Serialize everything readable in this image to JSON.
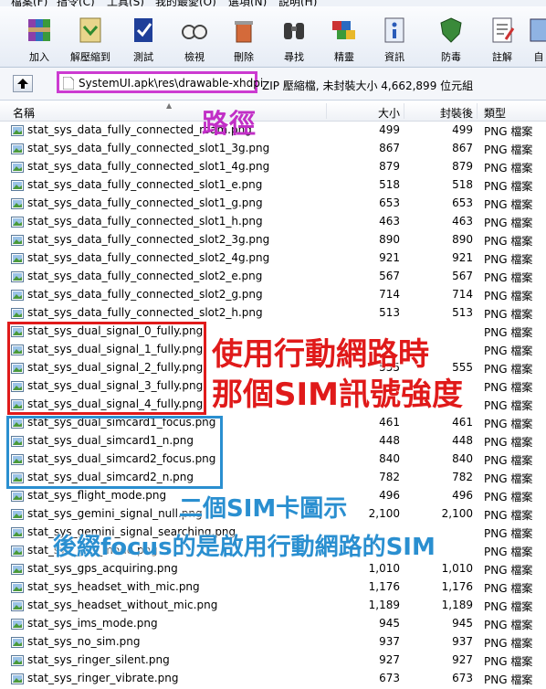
{
  "menu": [
    "檔案(F)",
    "指令(C)",
    "工具(S)",
    "我的最愛(O)",
    "選項(N)",
    "說明(H)"
  ],
  "toolbar": [
    {
      "label": "加入",
      "icon": "rar-archive-icon"
    },
    {
      "label": "解壓縮到",
      "icon": "extract-icon"
    },
    {
      "label": "測試",
      "icon": "test-icon"
    },
    {
      "label": "檢視",
      "icon": "view-icon"
    },
    {
      "label": "刪除",
      "icon": "delete-icon"
    },
    {
      "label": "尋找",
      "icon": "find-binoculars-icon"
    },
    {
      "label": "精靈",
      "icon": "wizard-icon"
    },
    {
      "label": "資訊",
      "icon": "info-icon"
    },
    {
      "label": "防毒",
      "icon": "antivirus-icon"
    },
    {
      "label": "註解",
      "icon": "comment-icon"
    },
    {
      "label": "自",
      "icon": "sfx-icon"
    }
  ],
  "address": {
    "path": "SystemUI.apk\\res\\drawable-xhdpi",
    "info": "ZIP 壓縮檔, 未封裝大小 4,662,899 位元組"
  },
  "columns": {
    "name": "名稱",
    "size": "大小",
    "packed": "封裝後",
    "type": "類型"
  },
  "files": [
    {
      "name": "stat_sys_data_fully_connected_roam.png",
      "size": "499",
      "packed": "499",
      "type": "PNG 檔案"
    },
    {
      "name": "stat_sys_data_fully_connected_slot1_3g.png",
      "size": "867",
      "packed": "867",
      "type": "PNG 檔案"
    },
    {
      "name": "stat_sys_data_fully_connected_slot1_4g.png",
      "size": "879",
      "packed": "879",
      "type": "PNG 檔案"
    },
    {
      "name": "stat_sys_data_fully_connected_slot1_e.png",
      "size": "518",
      "packed": "518",
      "type": "PNG 檔案"
    },
    {
      "name": "stat_sys_data_fully_connected_slot1_g.png",
      "size": "653",
      "packed": "653",
      "type": "PNG 檔案"
    },
    {
      "name": "stat_sys_data_fully_connected_slot1_h.png",
      "size": "463",
      "packed": "463",
      "type": "PNG 檔案"
    },
    {
      "name": "stat_sys_data_fully_connected_slot2_3g.png",
      "size": "890",
      "packed": "890",
      "type": "PNG 檔案"
    },
    {
      "name": "stat_sys_data_fully_connected_slot2_4g.png",
      "size": "921",
      "packed": "921",
      "type": "PNG 檔案"
    },
    {
      "name": "stat_sys_data_fully_connected_slot2_e.png",
      "size": "567",
      "packed": "567",
      "type": "PNG 檔案"
    },
    {
      "name": "stat_sys_data_fully_connected_slot2_g.png",
      "size": "714",
      "packed": "714",
      "type": "PNG 檔案"
    },
    {
      "name": "stat_sys_data_fully_connected_slot2_h.png",
      "size": "513",
      "packed": "513",
      "type": "PNG 檔案"
    },
    {
      "name": "stat_sys_dual_signal_0_fully.png",
      "size": "",
      "packed": "",
      "type": "PNG 檔案"
    },
    {
      "name": "stat_sys_dual_signal_1_fully.png",
      "size": "",
      "packed": "",
      "type": "PNG 檔案"
    },
    {
      "name": "stat_sys_dual_signal_2_fully.png",
      "size": "555",
      "packed": "555",
      "type": "PNG 檔案"
    },
    {
      "name": "stat_sys_dual_signal_3_fully.png",
      "size": "",
      "packed": "",
      "type": "PNG 檔案"
    },
    {
      "name": "stat_sys_dual_signal_4_fully.png",
      "size": "",
      "packed": "",
      "type": "PNG 檔案"
    },
    {
      "name": "stat_sys_dual_simcard1_focus.png",
      "size": "461",
      "packed": "461",
      "type": "PNG 檔案"
    },
    {
      "name": "stat_sys_dual_simcard1_n.png",
      "size": "448",
      "packed": "448",
      "type": "PNG 檔案"
    },
    {
      "name": "stat_sys_dual_simcard2_focus.png",
      "size": "840",
      "packed": "840",
      "type": "PNG 檔案"
    },
    {
      "name": "stat_sys_dual_simcard2_n.png",
      "size": "782",
      "packed": "782",
      "type": "PNG 檔案"
    },
    {
      "name": "stat_sys_flight_mode.png",
      "size": "496",
      "packed": "496",
      "type": "PNG 檔案"
    },
    {
      "name": "stat_sys_gemini_signal_null.png",
      "size": "2,100",
      "packed": "2,100",
      "type": "PNG 檔案"
    },
    {
      "name": "stat_sys_gemini_signal_searching.png",
      "size": "",
      "packed": "",
      "type": "PNG 檔案"
    },
    {
      "name": "stat_sys_gps_mode.png",
      "size": "",
      "packed": "",
      "type": "PNG 檔案"
    },
    {
      "name": "stat_sys_gps_acquiring.png",
      "size": "1,010",
      "packed": "1,010",
      "type": "PNG 檔案"
    },
    {
      "name": "stat_sys_headset_with_mic.png",
      "size": "1,176",
      "packed": "1,176",
      "type": "PNG 檔案"
    },
    {
      "name": "stat_sys_headset_without_mic.png",
      "size": "1,189",
      "packed": "1,189",
      "type": "PNG 檔案"
    },
    {
      "name": "stat_sys_ims_mode.png",
      "size": "945",
      "packed": "945",
      "type": "PNG 檔案"
    },
    {
      "name": "stat_sys_no_sim.png",
      "size": "937",
      "packed": "937",
      "type": "PNG 檔案"
    },
    {
      "name": "stat_sys_ringer_silent.png",
      "size": "927",
      "packed": "927",
      "type": "PNG 檔案"
    },
    {
      "name": "stat_sys_ringer_vibrate.png",
      "size": "673",
      "packed": "673",
      "type": "PNG 檔案"
    }
  ],
  "annotations": {
    "path": "路徑",
    "signal_line1": "使用行動網路時",
    "signal_line2": "那個SIM訊號強度",
    "sim_line1": "二個SIM卡圖示",
    "sim_line2": "後綴focus的是啟用行動網路的SIM",
    "colors": {
      "path": "#c12fc6",
      "signal": "#e01a1a",
      "sim": "#2a8fd0"
    }
  }
}
